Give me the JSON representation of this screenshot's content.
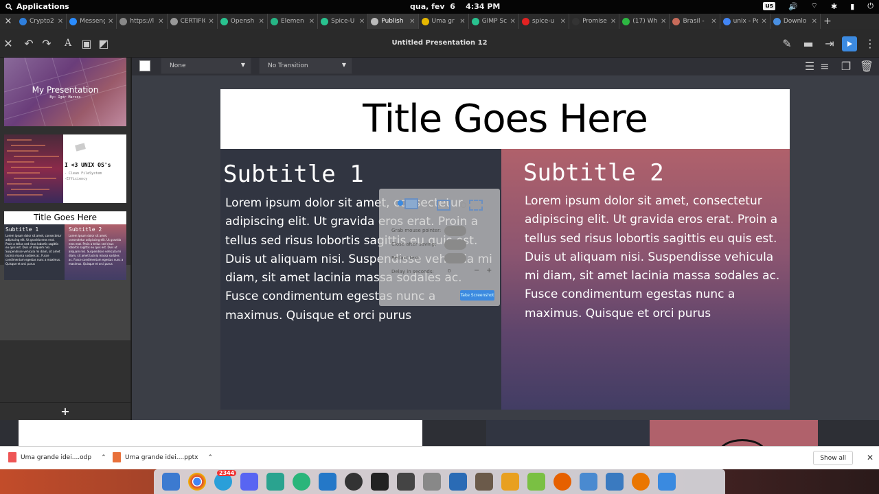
{
  "top_panel": {
    "applications": "Applications",
    "clock": "qua, fev  6    4:34 PM",
    "keyboard": "us"
  },
  "tabs": [
    {
      "label": "Crypto2",
      "color": "#2f7fdd"
    },
    {
      "label": "Messenger",
      "color": "#2a8cff"
    },
    {
      "label": "https://l",
      "color": "#888888"
    },
    {
      "label": "CERTIFIC",
      "color": "#999999"
    },
    {
      "label": "Opensh",
      "color": "#29c28f"
    },
    {
      "label": "Elemen",
      "color": "#26b585"
    },
    {
      "label": "Spice-U",
      "color": "#29c28f"
    },
    {
      "label": "Publish",
      "color": "#bbbbbb",
      "active": true
    },
    {
      "label": "Uma gr",
      "color": "#e6b800"
    },
    {
      "label": "GIMP Sc",
      "color": "#29c28f"
    },
    {
      "label": "spice-u",
      "color": "#e22222"
    },
    {
      "label": "Promise",
      "color": "#333333"
    },
    {
      "label": "(17) Wh",
      "color": "#2db742"
    },
    {
      "label": "Brasil -",
      "color": "#c86b5a"
    },
    {
      "label": "unix - Pe",
      "color": "#4285f4"
    },
    {
      "label": "Downlo",
      "color": "#4a90e2"
    }
  ],
  "header": {
    "title": "Untitled Presentation 12"
  },
  "toolbar": {
    "fill_select": "None",
    "transition_select": "No Transition"
  },
  "thumbnails": {
    "t1": {
      "title": "My Presentation",
      "subtitle": "By: Igor Marcos"
    },
    "t2": {
      "title": "I <3 UNIX OS's",
      "items": "- Clean FileSystem\n-Efficiency"
    },
    "t3": {
      "title": "Title Goes Here",
      "sub1": "Subtitle 1",
      "sub2": "Subtitle 2"
    }
  },
  "add_slide": "+",
  "slide": {
    "title": "Title Goes Here",
    "subtitle1": "Subtitle 1",
    "subtitle2": "Subtitle 2",
    "body1": "Lorem ipsum dolor sit amet, consectetur adipiscing elit. Ut gravida eros erat. Proin a tellus sed risus lobortis sagittis eu quis est. Duis ut aliquam nisi. Suspendisse vehicula mi diam, sit amet lacinia massa sodales ac. Fusce condimentum egestas nunc a maximus. Quisque et orci purus",
    "body2": "Lorem ipsum dolor sit amet, consectetur adipiscing elit. Ut gravida eros erat. Proin a tellus sed risus lobortis sagittis eu quis est. Duis ut aliquam nisi. Suspendisse vehicula mi diam, sit amet lacinia massa sodales ac. Fusce condimentum egestas nunc a maximus. Quisque et orci purus"
  },
  "screenshot_dialog": {
    "grab_pointer": "Grab mouse pointer:",
    "close_after": "Close after saving:",
    "redact": "Redact text:",
    "delay": "Delay in seconds:",
    "delay_value": "0",
    "take": "Take Screenshot"
  },
  "downloads": [
    {
      "name": "Uma grande idei....odp"
    },
    {
      "name": "Uma grande idei....pptx"
    }
  ],
  "show_all": "Show all",
  "dock": {
    "badge": "2344"
  },
  "colors": {
    "accent": "#3c8ae0",
    "slide_dark": "#313541",
    "gradient_top": "#b0616b",
    "gradient_bottom": "#423d64"
  }
}
